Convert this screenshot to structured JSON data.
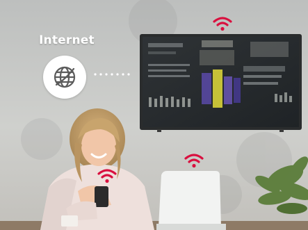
{
  "labels": {
    "internet": "Internet"
  },
  "icons": {
    "globe": "globe-icon",
    "wifi": "wifi-icon"
  },
  "colors": {
    "wifi_accent": "#d9103f",
    "badge_background": "#ffffff",
    "label_text": "#ffffff"
  }
}
